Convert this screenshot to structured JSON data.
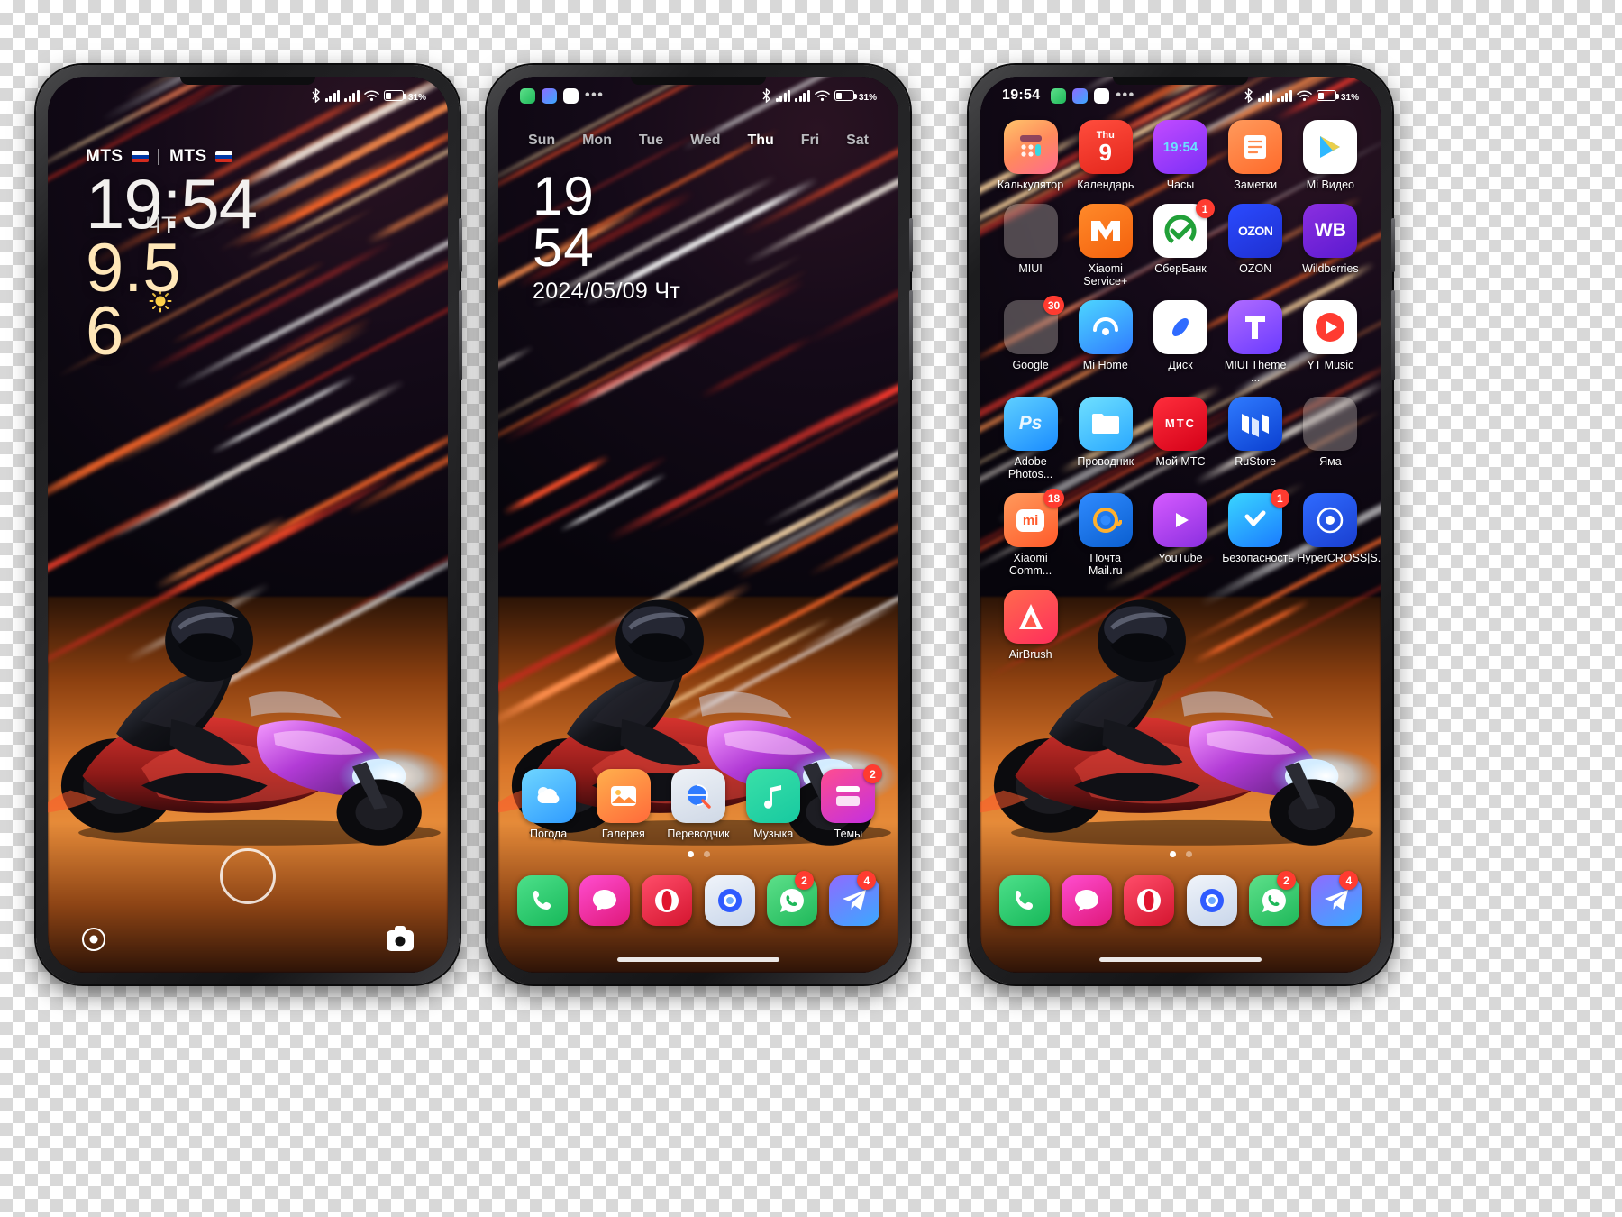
{
  "meta": {
    "screens": 3,
    "theme_accent": "#ff6a2a"
  },
  "statusbar": {
    "time": "19:54",
    "battery_percent": "31",
    "percent_symbol": "%",
    "icons": [
      "bluetooth-icon",
      "signal-sim1-icon",
      "signal-sim2-icon",
      "wifi-icon",
      "battery-icon"
    ],
    "notification_icons": [
      "whatsapp-icon",
      "telegram-icon",
      "play-store-icon"
    ],
    "overflow": "•••"
  },
  "lockscreen": {
    "carrier1": "MTS",
    "carrier_separator": "|",
    "carrier2": "MTS",
    "time": "19:54",
    "date_big": "9.5",
    "date_big2": "6",
    "day_short": "ЧТ",
    "weather_icon": "sun-icon",
    "unlock_icon": "fingerprint-ring-icon",
    "left_shortcut": "assistant-icon",
    "right_shortcut": "camera-icon"
  },
  "homescreen": {
    "weekdays": [
      {
        "label": "Sun",
        "active": false
      },
      {
        "label": "Mon",
        "active": false
      },
      {
        "label": "Tue",
        "active": false
      },
      {
        "label": "Wed",
        "active": false
      },
      {
        "label": "Thu",
        "active": true
      },
      {
        "label": "Fri",
        "active": false
      },
      {
        "label": "Sat",
        "active": false
      }
    ],
    "clock_hours": "19",
    "clock_minutes": "54",
    "date_full": "2024/05/09 Чт",
    "apps": [
      {
        "label": "Погода",
        "icon": "weather-icon",
        "badge": null
      },
      {
        "label": "Галерея",
        "icon": "gallery-icon",
        "badge": null
      },
      {
        "label": "Переводчик",
        "icon": "translate-icon",
        "badge": null
      },
      {
        "label": "Музыка",
        "icon": "music-icon",
        "badge": null
      },
      {
        "label": "Темы",
        "icon": "themes-icon",
        "badge": "2"
      }
    ],
    "page_dots": {
      "count": 2,
      "active": 0
    }
  },
  "appgrid": {
    "apps": [
      {
        "label": "Калькулятор",
        "icon": "calculator-icon",
        "badge": null
      },
      {
        "label": "Календарь",
        "icon": "calendar-icon",
        "badge": null,
        "cal_day_name": "Thu",
        "cal_day_num": "9"
      },
      {
        "label": "Часы",
        "icon": "clock-icon",
        "badge": null,
        "clock_text": "19:54"
      },
      {
        "label": "Заметки",
        "icon": "notes-icon",
        "badge": null
      },
      {
        "label": "Mi Видео",
        "icon": "mi-video-icon",
        "badge": null
      },
      {
        "label": "MIUI",
        "icon": "folder-icon",
        "badge": null
      },
      {
        "label": "Xiaomi Service+",
        "icon": "xiaomi-service-icon",
        "badge": null
      },
      {
        "label": "СберБанк",
        "icon": "sberbank-icon",
        "badge": "1"
      },
      {
        "label": "OZON",
        "icon": "ozon-icon",
        "badge": null,
        "wordmark": "OZON"
      },
      {
        "label": "Wildberries",
        "icon": "wildberries-icon",
        "badge": null,
        "wordmark": "WB"
      },
      {
        "label": "Google",
        "icon": "folder-icon",
        "badge": "30"
      },
      {
        "label": "Mi Home",
        "icon": "mi-home-icon",
        "badge": null
      },
      {
        "label": "Диск",
        "icon": "yandex-disk-icon",
        "badge": null
      },
      {
        "label": "MIUI Theme ...",
        "icon": "miui-theme-editor-icon",
        "badge": null
      },
      {
        "label": "YT Music",
        "icon": "yt-music-icon",
        "badge": null
      },
      {
        "label": "Adobe Photos...",
        "icon": "photoshop-icon",
        "badge": null,
        "wordmark": "Ps"
      },
      {
        "label": "Проводник",
        "icon": "file-manager-icon",
        "badge": null
      },
      {
        "label": "Мой МТС",
        "icon": "mts-icon",
        "badge": null,
        "wordmark": "МТС"
      },
      {
        "label": "RuStore",
        "icon": "rustore-icon",
        "badge": null
      },
      {
        "label": "Яма",
        "icon": "folder-icon",
        "badge": null
      },
      {
        "label": "Xiaomi Comm...",
        "icon": "xiaomi-community-icon",
        "badge": "18"
      },
      {
        "label": "Почта Mail.ru",
        "icon": "mailru-icon",
        "badge": null
      },
      {
        "label": "YouTube",
        "icon": "youtube-icon",
        "badge": null
      },
      {
        "label": "Безопасность",
        "icon": "security-icon",
        "badge": "1"
      },
      {
        "label": "HyperCROSS|S...",
        "icon": "hypercross-icon",
        "badge": null
      },
      {
        "label": "AirBrush",
        "icon": "airbrush-icon",
        "badge": null
      }
    ],
    "page_dots": {
      "count": 2,
      "active": 0
    }
  },
  "dock": [
    {
      "icon": "phone-icon",
      "badge": null
    },
    {
      "icon": "messages-icon",
      "badge": null
    },
    {
      "icon": "opera-icon",
      "badge": null
    },
    {
      "icon": "browser-icon",
      "badge": null
    },
    {
      "icon": "whatsapp-icon",
      "badge": "2"
    },
    {
      "icon": "telegram-icon",
      "badge": "4"
    }
  ]
}
